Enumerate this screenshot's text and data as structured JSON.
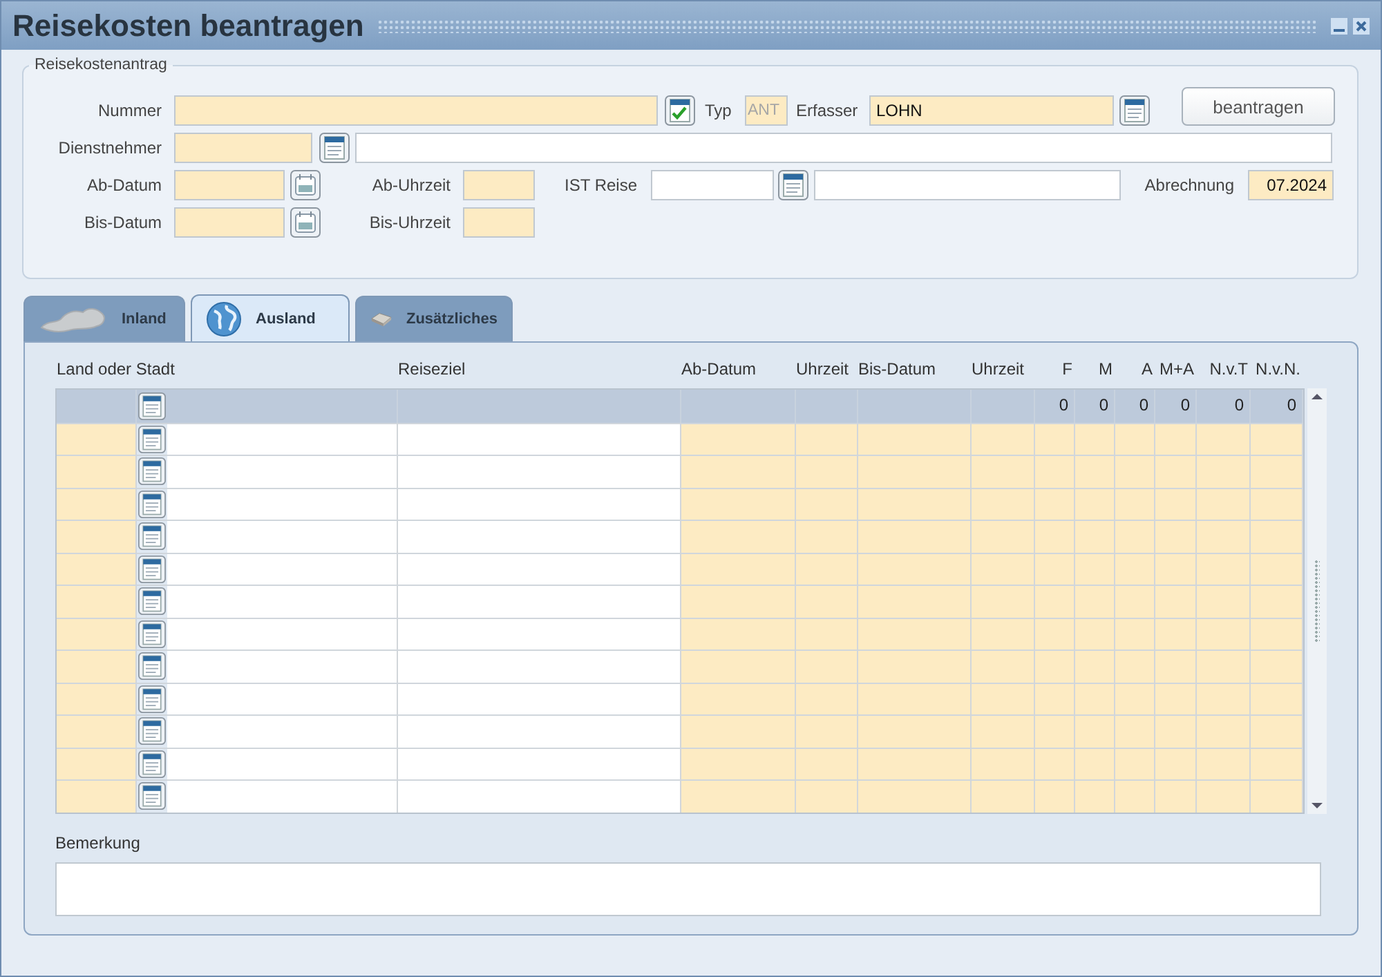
{
  "window": {
    "title": "Reisekosten beantragen"
  },
  "request": {
    "legend": "Reisekostenantrag",
    "nummer": {
      "label": "Nummer",
      "required": true
    },
    "typ": {
      "label": "Typ",
      "value": "ANT",
      "disabled": true
    },
    "erfasser": {
      "label": "Erfasser",
      "value": "LOHN",
      "required": true
    },
    "submit_button": "beantragen",
    "dienstnehmer": {
      "label": "Dienstnehmer",
      "required": true
    },
    "dienstnehmer_name": {
      "required": false
    },
    "ab_datum": {
      "label": "Ab-Datum",
      "required": true
    },
    "ab_uhrzeit": {
      "label": "Ab-Uhrzeit",
      "required": true
    },
    "ist_reise": {
      "label": "IST Reise",
      "required": false
    },
    "ist_reise_name": {
      "required": false
    },
    "abrechnung": {
      "label": "Abrechnung",
      "value": "07.2024",
      "required": true
    },
    "bis_datum": {
      "label": "Bis-Datum",
      "required": true
    },
    "bis_uhrzeit": {
      "label": "Bis-Uhrzeit",
      "required": true
    }
  },
  "tabs": [
    {
      "label": "Inland",
      "kind": "map",
      "selected": false
    },
    {
      "label": "Ausland",
      "kind": "globe",
      "selected": true
    },
    {
      "label": "Zusätzliches",
      "kind": "book",
      "selected": false
    }
  ],
  "table": {
    "columns": [
      "Land oder Stadt",
      "Reiseziel",
      "Ab-Datum",
      "Uhrzeit",
      "Bis-Datum",
      "Uhrzeit",
      "F",
      "M",
      "A",
      "M+A",
      "N.v.T",
      "N.v.N."
    ],
    "rows": [
      {
        "selected": true,
        "values": [
          "0",
          "0",
          "0",
          "0",
          "0",
          "0"
        ]
      },
      {
        "selected": false
      },
      {
        "selected": false
      },
      {
        "selected": false
      },
      {
        "selected": false
      },
      {
        "selected": false
      },
      {
        "selected": false
      },
      {
        "selected": false
      },
      {
        "selected": false
      },
      {
        "selected": false
      },
      {
        "selected": false
      },
      {
        "selected": false
      },
      {
        "selected": false
      }
    ]
  },
  "remark": {
    "label": "Bemerkung"
  }
}
